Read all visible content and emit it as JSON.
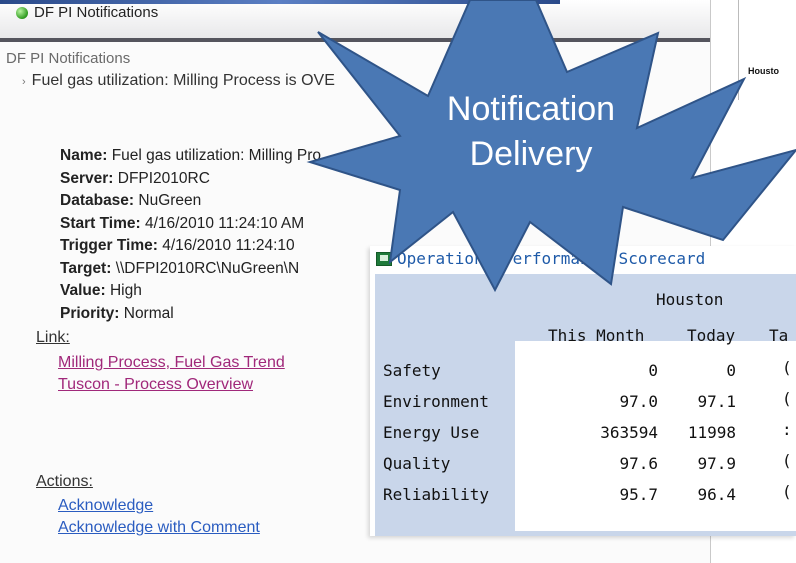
{
  "notification_window": {
    "title": "DF PI Notifications",
    "pane_header": "DF PI Notifications",
    "alert_summary": "Fuel gas utilization: Milling Process is OVE",
    "details": [
      {
        "label": "Name:",
        "value": " Fuel gas utilization: Milling Pro"
      },
      {
        "label": "Server:",
        "value": " DFPI2010RC"
      },
      {
        "label": "Database:",
        "value": " NuGreen"
      },
      {
        "label": "Start Time:",
        "value": " 4/16/2010 11:24:10 AM"
      },
      {
        "label": "Trigger Time:",
        "value": " 4/16/2010 11:24:10"
      },
      {
        "label": "Target:",
        "value": " \\\\DFPI2010RC\\NuGreen\\N"
      },
      {
        "label": "Value:",
        "value": " High"
      },
      {
        "label": "Priority:",
        "value": " Normal"
      }
    ],
    "link_label": "Link:",
    "links": [
      "Milling Process, Fuel Gas Trend",
      "Tuscon - Process Overview"
    ],
    "actions_label": "Actions:",
    "actions": [
      "Acknowledge",
      "Acknowledge with Comment"
    ]
  },
  "map_panel": {
    "label": "Housto"
  },
  "callout": {
    "line1": "Notification",
    "line2": "Delivery",
    "color": "#4a78b4"
  },
  "scorecard": {
    "title": "Operations Performance Scorecard",
    "group_header": "Houston",
    "columns": [
      "This Month",
      "Today",
      "Ta"
    ],
    "rows": [
      {
        "metric": "Safety",
        "this_month": "0",
        "today": "0",
        "extra": "("
      },
      {
        "metric": "Environment",
        "this_month": "97.0",
        "today": "97.1",
        "extra": "("
      },
      {
        "metric": "Energy Use",
        "this_month": "363594",
        "today": "11998",
        "extra": ":"
      },
      {
        "metric": "Quality",
        "this_month": "97.6",
        "today": "97.9",
        "extra": "("
      },
      {
        "metric": "Reliability",
        "this_month": "95.7",
        "today": "96.4",
        "extra": "("
      }
    ]
  }
}
